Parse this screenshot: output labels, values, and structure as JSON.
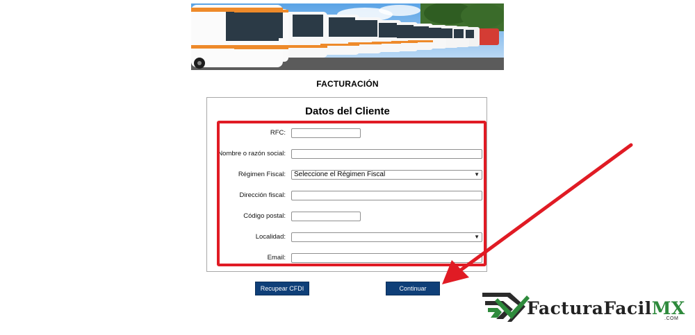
{
  "page": {
    "heading": "FACTURACIÓN"
  },
  "form": {
    "title": "Datos del Cliente",
    "fields": {
      "rfc": {
        "label": "RFC:",
        "value": ""
      },
      "nombre": {
        "label": "Nombre o razón social:",
        "value": ""
      },
      "regimen": {
        "label": "Régimen Fiscal:",
        "selected": "Seleccione el Régimen Fiscal"
      },
      "direccion": {
        "label": "Dirección fiscal:",
        "value": ""
      },
      "codigo_postal": {
        "label": "Código postal:",
        "value": ""
      },
      "localidad": {
        "label": "Localidad:",
        "selected": ""
      },
      "email": {
        "label": "Email:",
        "value": ""
      }
    }
  },
  "buttons": {
    "recover": "Recupear CFDI",
    "continue": "Continuar"
  },
  "logo": {
    "name_part": "FacturaFacil",
    "mx_part": "MX",
    "suffix": ".COM"
  },
  "colors": {
    "highlight": "#e01b24",
    "button_bg": "#0f3f78",
    "logo_green": "#2e8a3c"
  }
}
